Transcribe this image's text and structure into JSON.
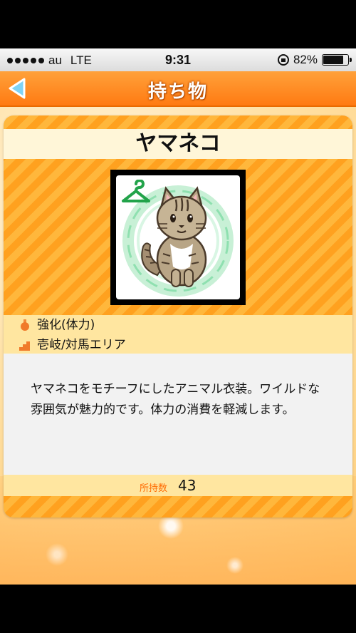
{
  "status_bar": {
    "carrier": "au",
    "network": "LTE",
    "time": "9:31",
    "battery_percent": "82%",
    "battery_level": 0.82
  },
  "header": {
    "title": "持ち物",
    "back_icon": "back-arrow-icon"
  },
  "item": {
    "name": "ヤマネコ",
    "image_icon": "cat-costume-icon",
    "badge_icon": "hanger-icon",
    "effect": "強化(体力)",
    "effect_icon": "potion-icon",
    "area": "壱岐/対馬エリア",
    "area_icon": "stairs-icon",
    "description": "ヤマネコをモチーフにしたアニマル衣装。ワイルドな雰囲気が魅力的です。体力の消費を軽減します。",
    "count_label": "所持数",
    "count_value": "43"
  },
  "colors": {
    "header_orange": "#ff7a12",
    "stripe_orange": "#ffa11f",
    "label_orange": "#ff6a00",
    "band_yellow": "#ffe6a0"
  }
}
